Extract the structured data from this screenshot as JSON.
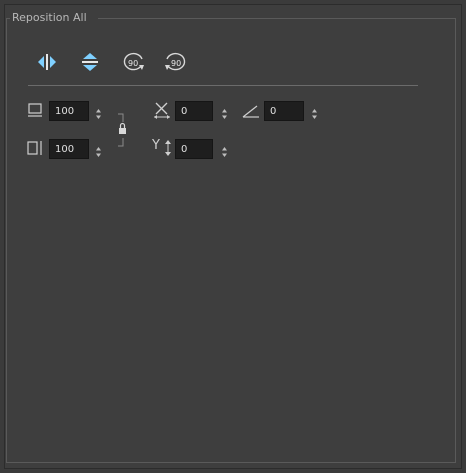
{
  "group": {
    "title": "Reposition All"
  },
  "toolbar": {
    "flip_horizontal_icon": "flip-horizontal-icon",
    "flip_vertical_icon": "flip-vertical-icon",
    "rotate_cw_label": "90",
    "rotate_ccw_label": "90"
  },
  "fields": {
    "width": {
      "value": "100",
      "icon": "width-icon"
    },
    "height": {
      "value": "100",
      "icon": "height-icon"
    },
    "x": {
      "value": "0",
      "icon": "x-offset-icon"
    },
    "y": {
      "value": "0",
      "icon": "y-offset-icon"
    },
    "angle": {
      "value": "0",
      "icon": "angle-icon"
    },
    "y_label": "Y"
  },
  "colors": {
    "accent": "#7fd0ff",
    "panel": "#3e3e3e",
    "field_bg": "#1e1e1e"
  }
}
